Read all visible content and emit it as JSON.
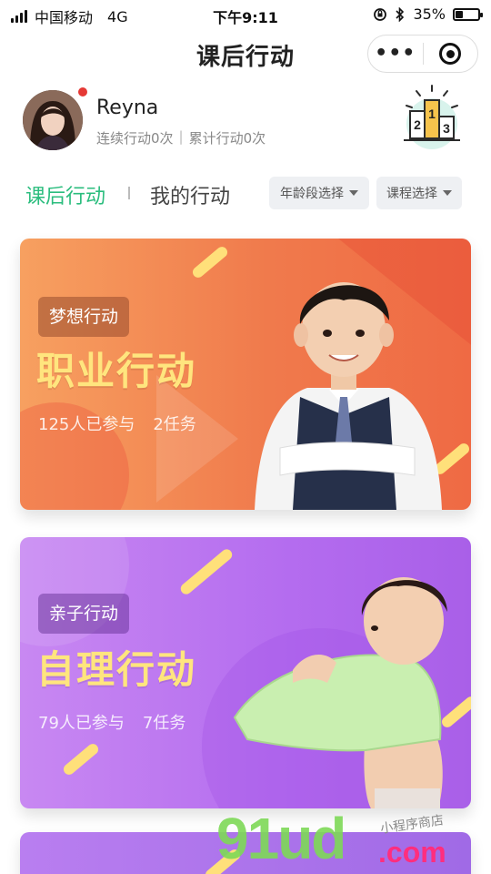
{
  "status_bar": {
    "carrier": "中国移动",
    "network": "4G",
    "time": "下午9:11",
    "battery_percent": "35%",
    "battery_level": 0.35
  },
  "nav": {
    "title": "课后行动",
    "more_icon": "more-dots-icon",
    "close_icon": "target-icon"
  },
  "profile": {
    "name": "Reyna",
    "streak": "连续行动0次",
    "total": "累计行动0次",
    "separator": "|",
    "rank_icon": "podium-icon",
    "rank_labels": [
      "2",
      "1",
      "3"
    ]
  },
  "tabs": {
    "active": "课后行动",
    "inactive": "我的行动",
    "filters": [
      "年龄段选择",
      "课程选择"
    ]
  },
  "cards": [
    {
      "tag": "梦想行动",
      "title": "职业行动",
      "participants": "125人已参与",
      "tasks": "2任务"
    },
    {
      "tag": "亲子行动",
      "title": "自理行动",
      "participants": "79人已参与",
      "tasks": "7任务"
    }
  ],
  "watermark": {
    "brand": "91ud",
    "domain": ".com",
    "shop": "小程序商店"
  },
  "colors": {
    "accent_green": "#2bbd7e",
    "card_orange": "#f07a4c",
    "card_purple": "#b46cef",
    "title_yellow": "#ffe57e"
  }
}
